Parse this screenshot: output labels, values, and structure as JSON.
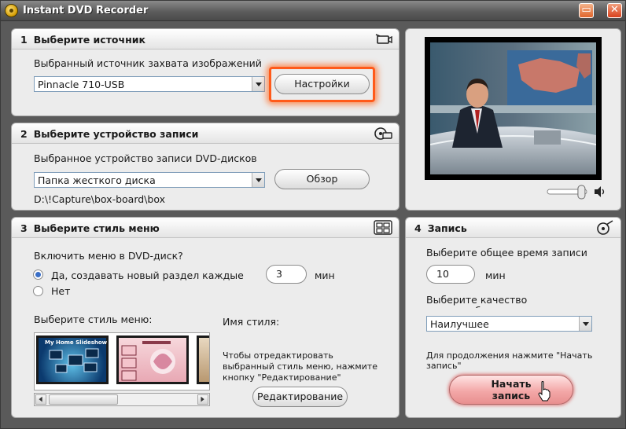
{
  "window": {
    "title": "Instant DVD Recorder",
    "min_glyph": "▭",
    "close_glyph": "✕"
  },
  "section1": {
    "number": "1",
    "title": "Выберите источник",
    "source_label": "Выбранный источник захвата изображений",
    "source_value": "Pinnacle 710-USB",
    "settings_button": "Настройки"
  },
  "section2": {
    "number": "2",
    "title": "Выберите устройство записи",
    "device_label": "Выбранное устройство записи DVD-дисков",
    "device_value": "Папка жесткого диска",
    "browse_button": "Обзор",
    "path": "D:\\!Capture\\box-board\\box"
  },
  "section3": {
    "number": "3",
    "title": "Выберите стиль меню",
    "include_menu_question": "Включить меню в DVD-диск?",
    "option_yes": "Да, создавать новый раздел каждые",
    "option_no": "Нет",
    "interval_value": "3",
    "interval_unit": "мин",
    "style_label": "Выберите стиль меню:",
    "style_name_label": "Имя стиля:",
    "edit_hint": "Чтобы отредактировать выбранный стиль меню, нажмите кнопку \"Редактирование\"",
    "edit_button": "Редактирование",
    "thumb_1_caption": "My Home Slideshow"
  },
  "section4": {
    "number": "4",
    "title": "Запись",
    "total_time_label": "Выберите общее время записи",
    "total_time_value": "10",
    "total_time_unit": "мин",
    "quality_label": "Выберите качество видеоизображения",
    "quality_value": "Наилучшее",
    "continue_hint": "Для продолжения нажмите \"Начать запись\"",
    "start_button_line1": "Начать",
    "start_button_line2": "запись"
  },
  "volume": {
    "level": 0.95
  },
  "colors": {
    "highlight": "#ff5a1a",
    "accent": "#3a6fc7"
  }
}
